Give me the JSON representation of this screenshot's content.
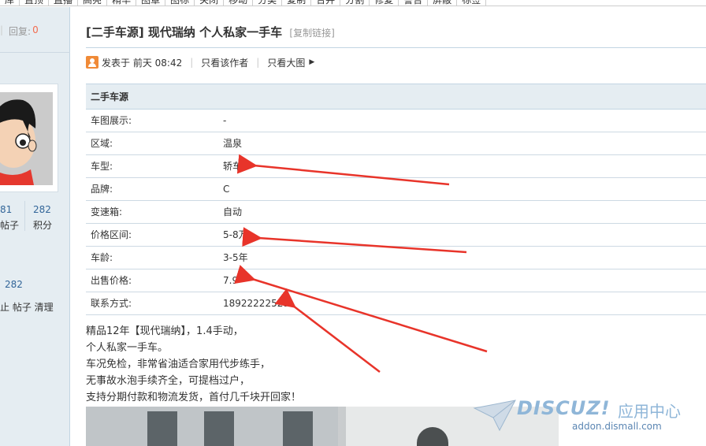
{
  "topbar": {
    "items": [
      "库",
      "置顶",
      "直播",
      "高亮",
      "精华",
      "图章",
      "图标",
      "关闭",
      "移动",
      "分类",
      "复制",
      "合并",
      "分割",
      "修复",
      "警告",
      "屏蔽",
      "标签"
    ]
  },
  "sidebar": {
    "reply_label": "回复:",
    "reply_count": "0",
    "posts_num": "81",
    "posts_label": "帖子",
    "points_num": "282",
    "points_label": "积分",
    "extra_num": "282",
    "actions": "止 帖子 清理"
  },
  "thread": {
    "title": "[二手车源] 现代瑞纳 个人私家一手车",
    "copy_link": "[复制链接]",
    "posted": "发表于 前天 08:42",
    "only_author": "只看该作者",
    "big_image": "只看大图"
  },
  "info_table": {
    "heading": "二手车源",
    "rows": [
      {
        "k": "车图展示:",
        "v": "-"
      },
      {
        "k": "区域:",
        "v": "温泉"
      },
      {
        "k": "车型:",
        "v": "轿车"
      },
      {
        "k": "品牌:",
        "v": "C"
      },
      {
        "k": "变速箱:",
        "v": "自动"
      },
      {
        "k": "价格区间:",
        "v": "5-8万"
      },
      {
        "k": "车龄:",
        "v": "3-5年"
      },
      {
        "k": "出售价格:",
        "v": "7.9"
      },
      {
        "k": "联系方式:",
        "v": "18922222529"
      }
    ]
  },
  "content": {
    "lines": [
      "精品12年【现代瑞纳】，1.4手动，",
      "个人私家一手车。",
      "车况免检，非常省油适合家用代步练手，",
      "无事故水泡手续齐全，可提档过户，",
      "支持分期付款和物流发货，首付几千块开回家！"
    ]
  },
  "watermark": {
    "logo": "DISCUZ!",
    "cn": "应用中心",
    "url": "addon.dismall.com"
  },
  "colors": {
    "accent_red": "#e8342a",
    "link_blue": "#336699",
    "table_head_bg": "#e5edf2"
  }
}
